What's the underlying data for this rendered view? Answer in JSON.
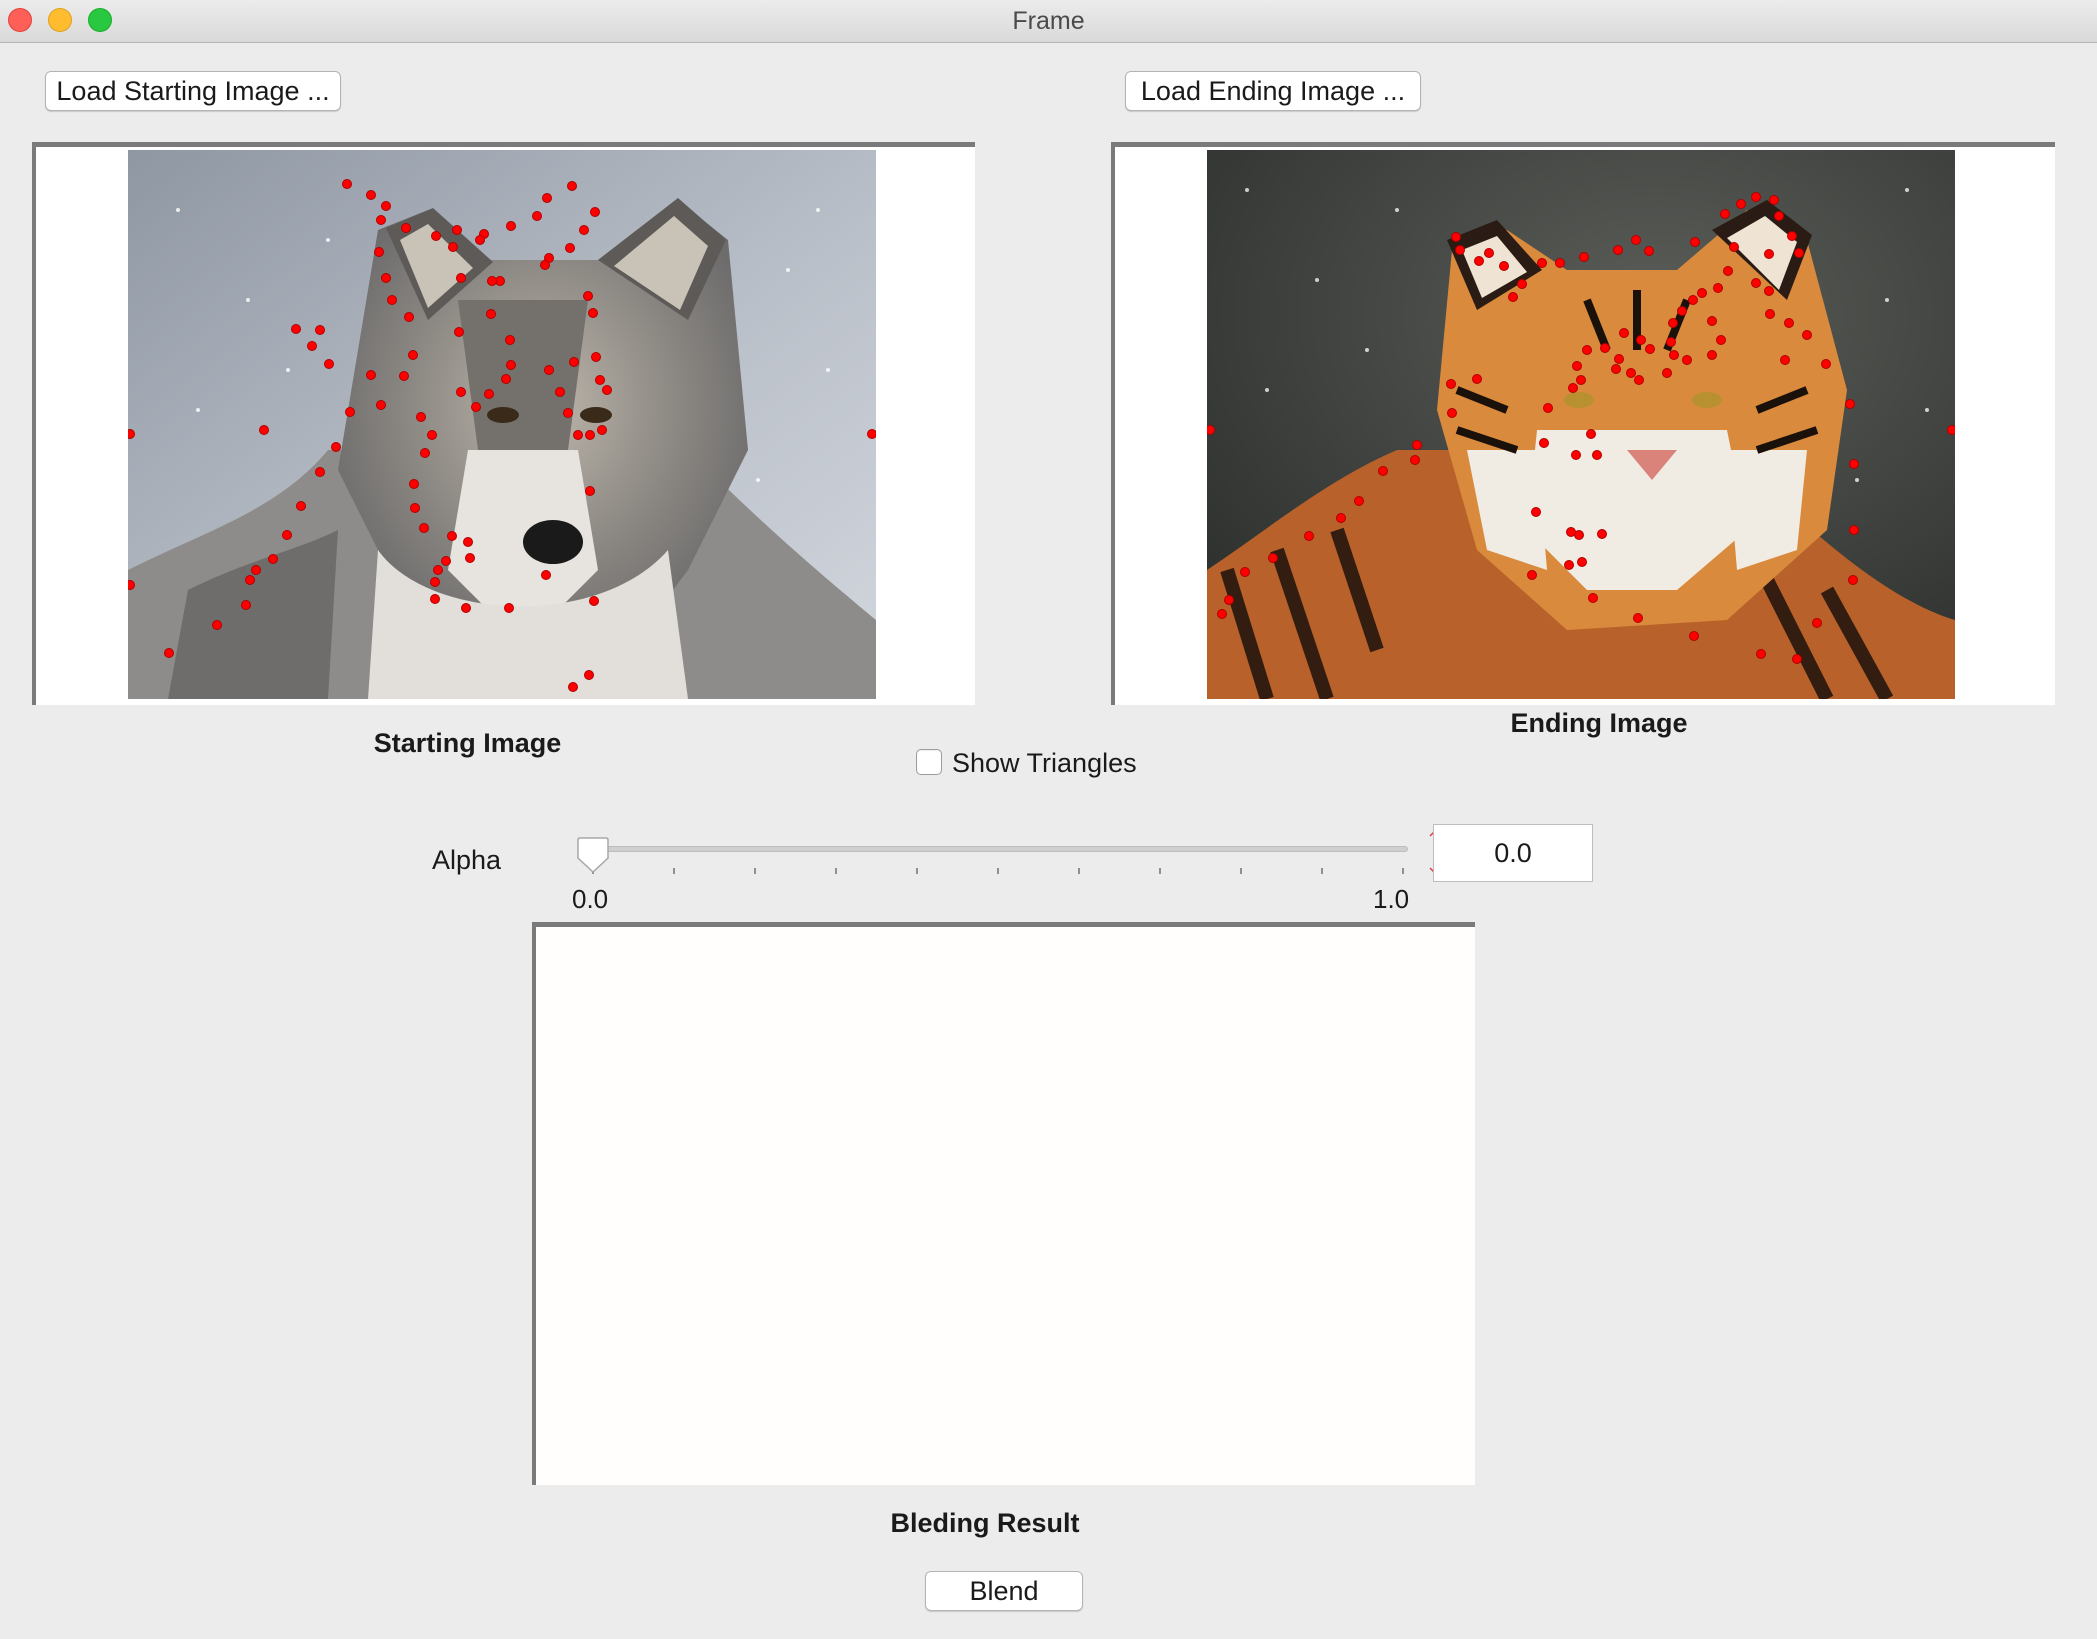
{
  "window": {
    "title": "Frame",
    "controls": [
      "close",
      "minimize",
      "zoom"
    ]
  },
  "toolbar": {
    "load_start_label": "Load Starting Image ...",
    "load_end_label": "Load Ending Image ..."
  },
  "panels": {
    "start_caption": "Starting Image",
    "end_caption": "Ending Image",
    "result_caption": "Bleding Result"
  },
  "options": {
    "show_triangles_label": "Show Triangles",
    "show_triangles_checked": false
  },
  "alpha": {
    "label": "Alpha",
    "min_label": "0.0",
    "max_label": "1.0",
    "value": "0.0",
    "fraction": 0.0
  },
  "actions": {
    "blend_label": "Blend"
  },
  "colors": {
    "control_point": "#ff0000",
    "panel_border": "#7a7a7a",
    "window_bg": "#ececec"
  }
}
